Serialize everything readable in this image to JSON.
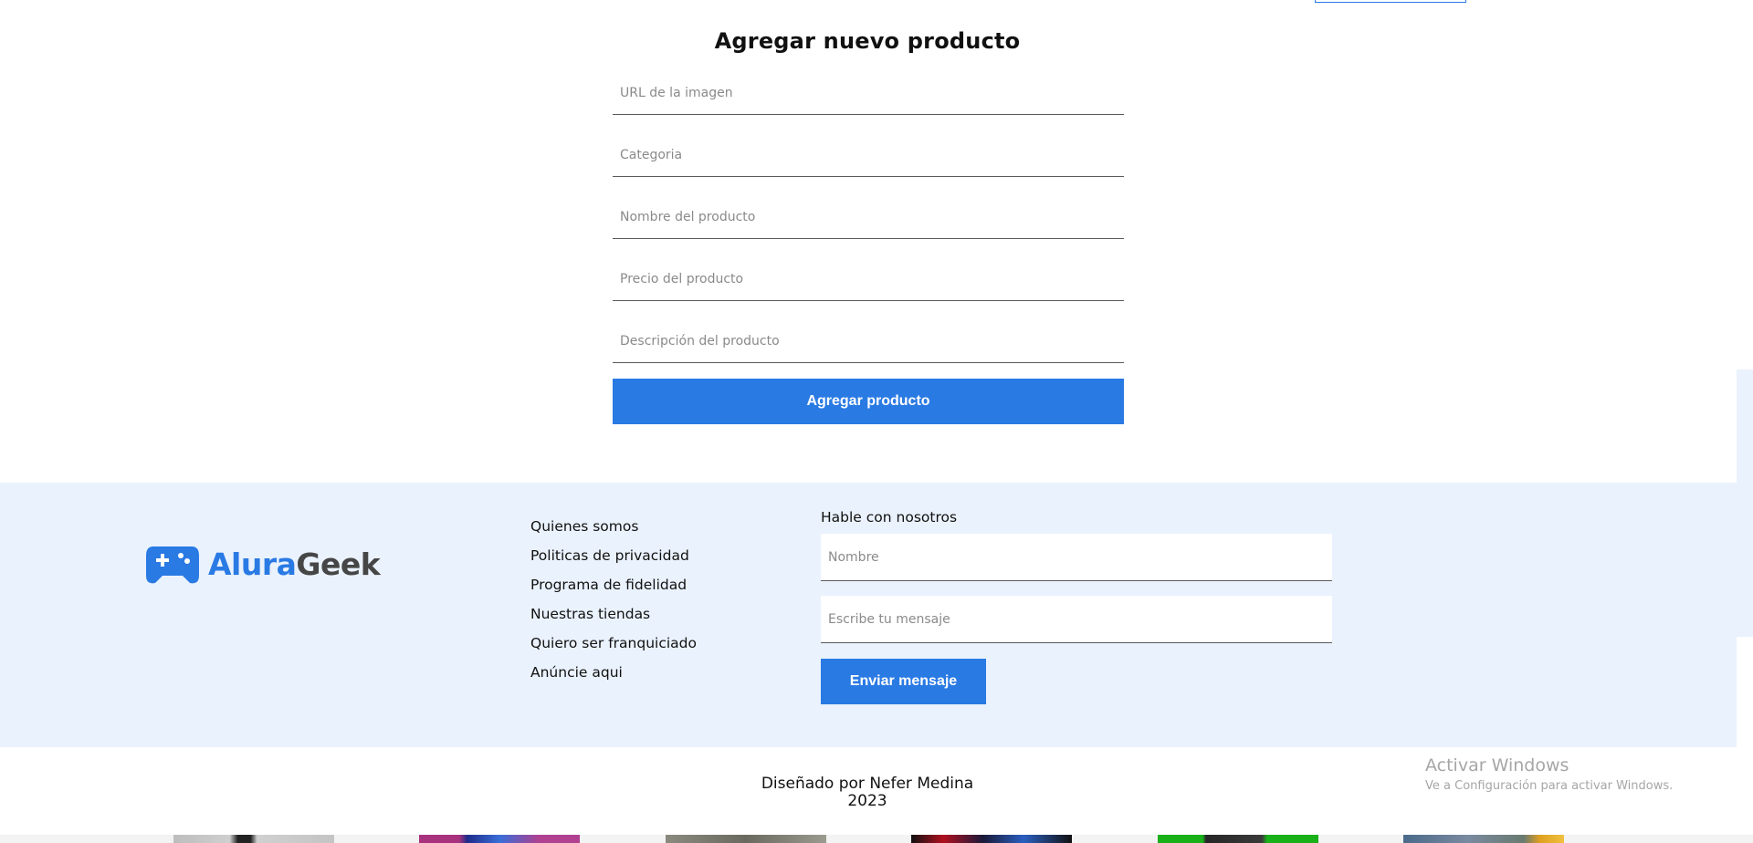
{
  "form": {
    "title": "Agregar nuevo producto",
    "fields": {
      "image_url": "URL de la imagen",
      "category": "Categoria",
      "name": "Nombre del producto",
      "price": "Precio del producto",
      "description": "Descripción del producto"
    },
    "submit_label": "Agregar producto"
  },
  "footer": {
    "logo": {
      "part1": "Alura",
      "part2": "Geek",
      "icon": "gamepad-icon"
    },
    "links": [
      "Quienes somos",
      "Politicas de privacidad",
      "Programa de fidelidad",
      "Nuestras tiendas",
      "Quiero ser franquiciado",
      "Anúncie aqui"
    ],
    "contact": {
      "title": "Hable con nosotros",
      "name_placeholder": "Nombre",
      "message_placeholder": "Escribe tu mensaje",
      "send_label": "Enviar mensaje"
    }
  },
  "credit": {
    "line1": "Diseñado por Nefer Medina",
    "line2": "2023"
  },
  "windows_watermark": {
    "title": "Activar Windows",
    "subtitle": "Ve a Configuración para activar Windows."
  },
  "colors": {
    "accent": "#2a7ae4",
    "footer_bg": "#eaf2fd",
    "text": "#111111"
  }
}
